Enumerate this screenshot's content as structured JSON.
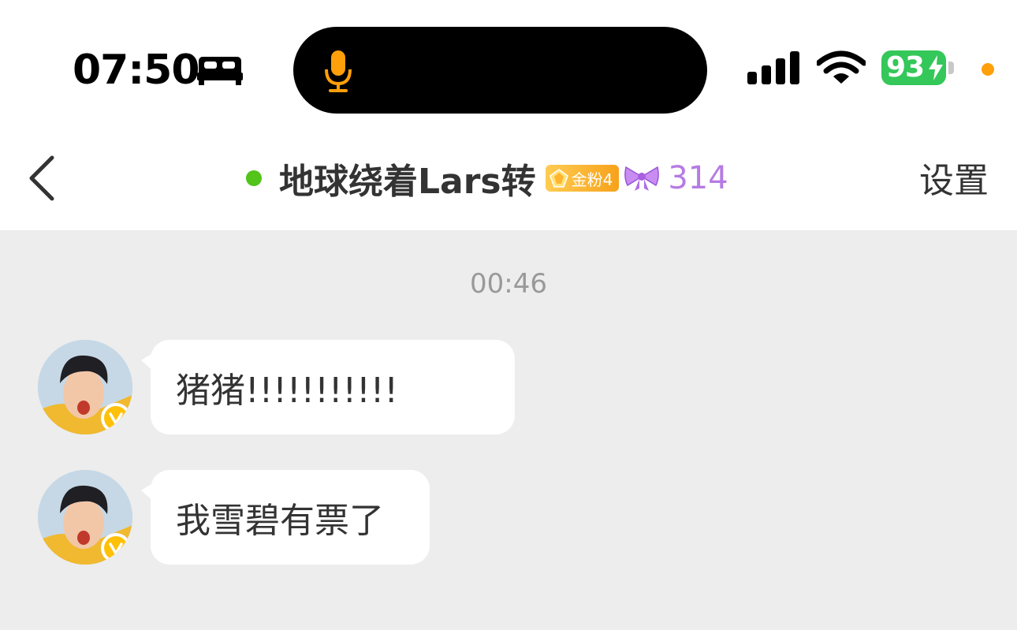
{
  "status_bar": {
    "time": "07:50",
    "battery": "93"
  },
  "nav": {
    "title": "地球绕着Lars转",
    "fan_badge": "金粉4",
    "bow_count": "314",
    "settings": "设置"
  },
  "chat": {
    "timestamp": "00:46",
    "messages": [
      {
        "text": "猪猪!!!!!!!!!!!"
      },
      {
        "text": "我雪碧有票了"
      }
    ]
  },
  "colors": {
    "online": "#52c41a",
    "battery": "#34c759",
    "mic": "#ff9f0a",
    "badge": "#f7a21b",
    "bow": "#b57be3"
  }
}
